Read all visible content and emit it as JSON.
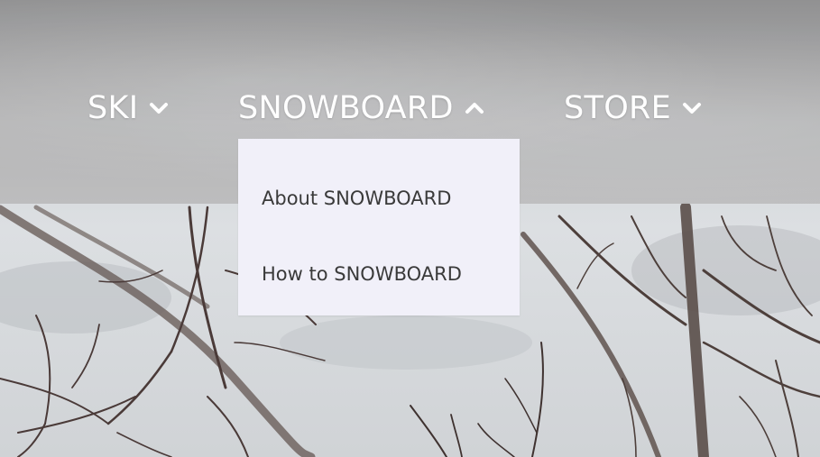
{
  "nav": {
    "items": [
      {
        "label": "SKI",
        "state": "collapsed"
      },
      {
        "label": "SNOWBOARD",
        "state": "expanded"
      },
      {
        "label": "STORE",
        "state": "collapsed"
      }
    ]
  },
  "dropdown": {
    "items": [
      {
        "label": "About SNOWBOARD"
      },
      {
        "label": "How to SNOWBOARD"
      }
    ]
  },
  "icons": {
    "collapsed": "chevron-down-icon",
    "expanded": "chevron-up-icon"
  },
  "colors": {
    "nav_text": "#ffffff",
    "dropdown_bg": "#f1f0f9",
    "dropdown_text": "#3a3a3a"
  }
}
